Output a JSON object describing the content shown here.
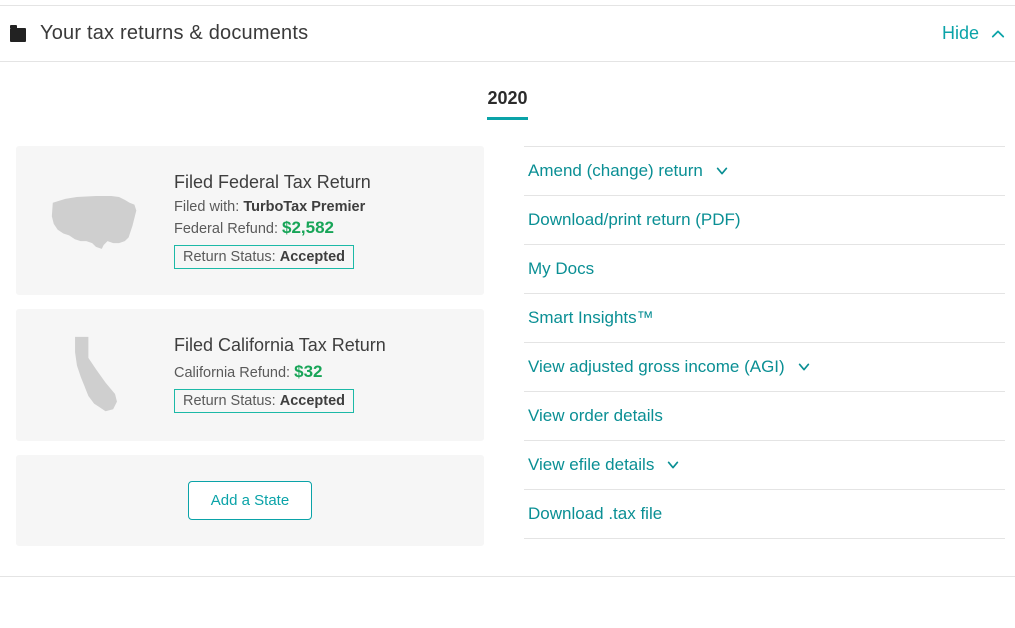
{
  "colors": {
    "accent": "#0aa3a8",
    "money": "#18a558"
  },
  "header": {
    "title": "Your tax returns & documents",
    "toggle_label": "Hide"
  },
  "year_tab": "2020",
  "federal": {
    "title": "Filed Federal Tax Return",
    "filed_with_label": "Filed with:",
    "filed_with_value": "TurboTax Premier",
    "refund_label": "Federal Refund:",
    "refund_value": "$2,582",
    "status_label": "Return Status:",
    "status_value": "Accepted"
  },
  "state": {
    "title": "Filed California Tax Return",
    "refund_label": "California Refund:",
    "refund_value": "$32",
    "status_label": "Return Status:",
    "status_value": "Accepted"
  },
  "add_state_label": "Add a State",
  "links": [
    {
      "label": "Amend (change) return",
      "chevron": true
    },
    {
      "label": "Download/print return (PDF)",
      "chevron": false
    },
    {
      "label": "My Docs",
      "chevron": false
    },
    {
      "label": "Smart Insights™",
      "chevron": false
    },
    {
      "label": "View adjusted gross income (AGI)",
      "chevron": true
    },
    {
      "label": "View order details",
      "chevron": false
    },
    {
      "label": "View efile details",
      "chevron": true
    },
    {
      "label": "Download .tax file",
      "chevron": false
    }
  ]
}
